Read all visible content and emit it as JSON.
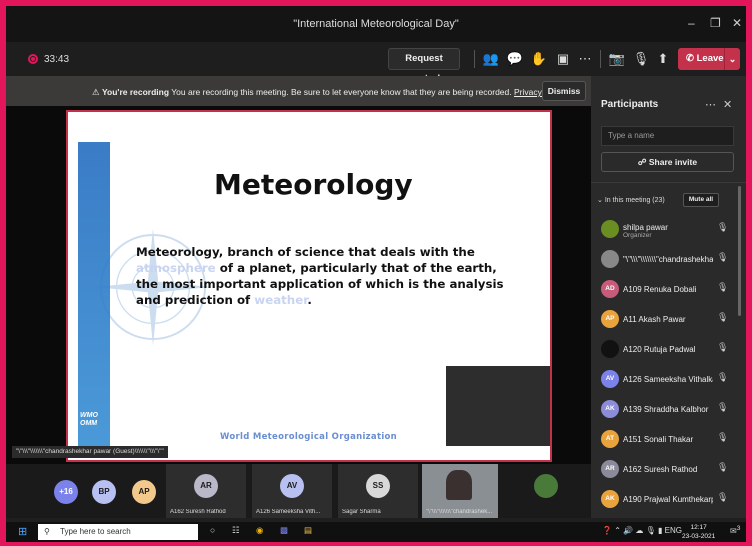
{
  "window": {
    "title": "\"International Meteorological Day\""
  },
  "toolbar": {
    "timer": "33:43",
    "request_control": "Request control",
    "leave": "Leave"
  },
  "banner": {
    "bold": "You're recording",
    "text": "You are recording this meeting. Be sure to let everyone know that they are being recorded.",
    "link": "Privacy policy",
    "dismiss": "Dismiss"
  },
  "slide": {
    "heading": "Meteorology",
    "body_1": "Meteorology, branch of science that deals with the ",
    "link_1": "atmosphere",
    "body_2": " of a planet, particularly that of the earth, the most important application of which is the analysis and prediction of ",
    "link_2": "weather",
    "body_3": ".",
    "footer": "World Meteorological Organization",
    "logo_text": "WMO OMM"
  },
  "presenter_label": "\"\\\"\\\\\\\"\\\\\\\\\\\\\\\"chandrashekhar pawar (Guest)\\\\\\\\\\\\\\\"\\\\\\\"\\\"\"",
  "participants": {
    "title": "Participants",
    "search_placeholder": "Type a name",
    "share_invite": "Share invite",
    "in_meeting": "In this meeting (23)",
    "mute_all": "Mute all",
    "list": [
      {
        "initials": "",
        "name": "shilpa pawar",
        "role": "Organizer",
        "color": "#6b8e23"
      },
      {
        "initials": "",
        "name": "\"\\\"\\\\\\\"\\\\\\\\\\\\\\\"chandrashekha...",
        "role": "",
        "color": "#888888"
      },
      {
        "initials": "AD",
        "name": "A109 Renuka Dobali",
        "role": "",
        "color": "#c75b7a"
      },
      {
        "initials": "AP",
        "name": "A11 Akash Pawar",
        "role": "",
        "color": "#e8a33d"
      },
      {
        "initials": "",
        "name": "A120 Rutuja Padwal",
        "role": "",
        "color": "#111111"
      },
      {
        "initials": "AV",
        "name": "A126 Sameeksha Vithalkar",
        "role": "",
        "color": "#7b83eb"
      },
      {
        "initials": "AK",
        "name": "A139 Shraddha Kalbhor",
        "role": "",
        "color": "#8c8cd8"
      },
      {
        "initials": "AT",
        "name": "A151 Sonali Thakar",
        "role": "",
        "color": "#e8a33d"
      },
      {
        "initials": "AR",
        "name": "A162 Suresh Rathod",
        "role": "",
        "color": "#8a8a9a"
      },
      {
        "initials": "AK",
        "name": "A190 Prajwal Kumthekarpatil",
        "role": "",
        "color": "#e8a33d"
      }
    ]
  },
  "strip": {
    "more": "+16",
    "bp": "BP",
    "ap": "AP",
    "tiles": [
      {
        "initials": "AR",
        "label": "A162 Suresh Rathod"
      },
      {
        "initials": "AV",
        "label": "A126 Sameeksha Vith..."
      },
      {
        "initials": "SS",
        "label": "Sagar Sharma"
      },
      {
        "initials": "",
        "label": "\"\\\"\\\\\\\"\\\\\\\\\\\\\\\"chandrashek..."
      }
    ]
  },
  "taskbar": {
    "search_placeholder": "Type here to search",
    "lang": "ENG",
    "time": "12:17",
    "date": "23-03-2021",
    "notif_count": "3"
  }
}
